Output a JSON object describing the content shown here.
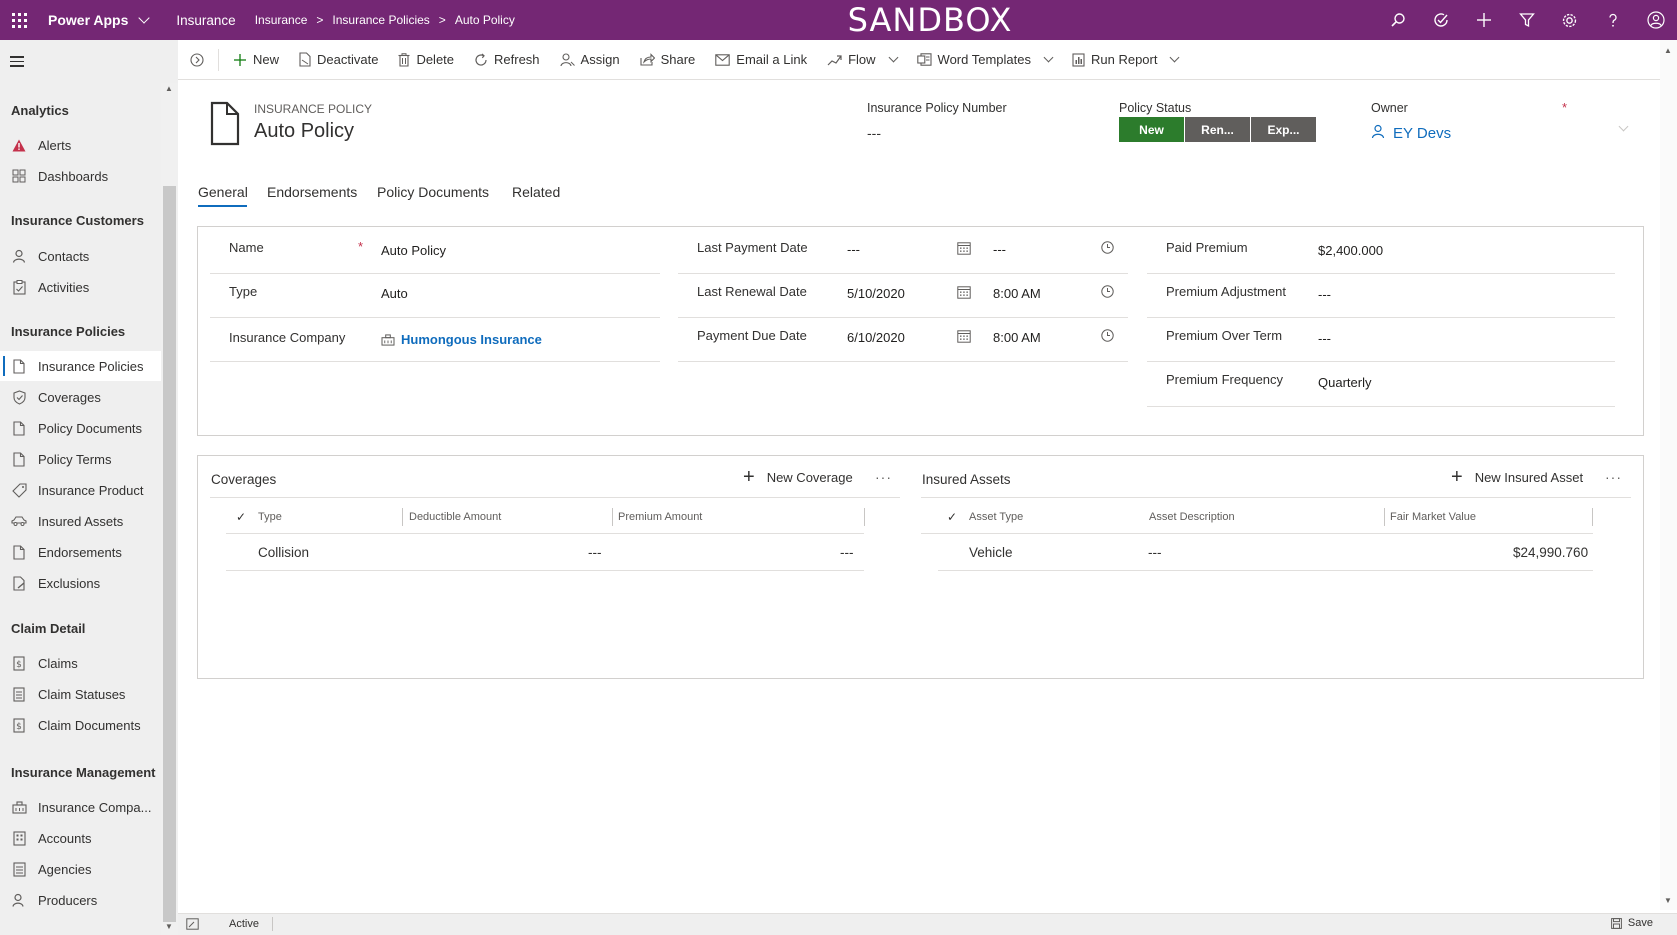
{
  "topbar": {
    "app_name": "Power Apps",
    "environment": "Insurance",
    "breadcrumbs": [
      "Insurance",
      "Insurance Policies",
      "Auto Policy"
    ],
    "banner": "SANDBOX",
    "icons": [
      "search-icon",
      "task-icon",
      "plus-icon",
      "filter-icon",
      "settings-icon",
      "help-icon"
    ]
  },
  "sidebar": {
    "groups": [
      {
        "title": "Analytics",
        "items": [
          {
            "label": "Alerts",
            "icon": "alert-icon"
          },
          {
            "label": "Dashboards",
            "icon": "dashboard-icon"
          }
        ]
      },
      {
        "title": "Insurance Customers",
        "items": [
          {
            "label": "Contacts",
            "icon": "person-icon"
          },
          {
            "label": "Activities",
            "icon": "clipboard-icon"
          }
        ]
      },
      {
        "title": "Insurance Policies",
        "items": [
          {
            "label": "Insurance Policies",
            "icon": "document-icon",
            "active": true
          },
          {
            "label": "Coverages",
            "icon": "shield-icon"
          },
          {
            "label": "Policy Documents",
            "icon": "document-icon"
          },
          {
            "label": "Policy Terms",
            "icon": "document-icon"
          },
          {
            "label": "Insurance Product",
            "icon": "tag-icon"
          },
          {
            "label": "Insured Assets",
            "icon": "car-icon"
          },
          {
            "label": "Endorsements",
            "icon": "document-icon"
          },
          {
            "label": "Exclusions",
            "icon": "document-edit-icon"
          }
        ]
      },
      {
        "title": "Claim Detail",
        "items": [
          {
            "label": "Claims",
            "icon": "dollar-doc-icon"
          },
          {
            "label": "Claim Statuses",
            "icon": "list-doc-icon"
          },
          {
            "label": "Claim Documents",
            "icon": "dollar-doc-icon"
          }
        ]
      },
      {
        "title": "Insurance Management",
        "items": [
          {
            "label": "Insurance Compa...",
            "icon": "building-icon"
          },
          {
            "label": "Accounts",
            "icon": "building-icon"
          },
          {
            "label": "Agencies",
            "icon": "building-icon"
          },
          {
            "label": "Producers",
            "icon": "person-icon"
          }
        ]
      }
    ]
  },
  "commands": {
    "new": "New",
    "deactivate": "Deactivate",
    "delete": "Delete",
    "refresh": "Refresh",
    "assign": "Assign",
    "share": "Share",
    "email_link": "Email a Link",
    "flow": "Flow",
    "word_templates": "Word Templates",
    "run_report": "Run Report"
  },
  "header": {
    "entity": "INSURANCE POLICY",
    "title": "Auto Policy",
    "policy_number_label": "Insurance Policy Number",
    "policy_number_value": "---",
    "status_label": "Policy Status",
    "status_stages": [
      {
        "label": "New",
        "active": true
      },
      {
        "label": "Ren...",
        "active": false
      },
      {
        "label": "Exp...",
        "active": false
      }
    ],
    "owner_label": "Owner",
    "owner_value": "EY Devs",
    "required_mark": "*"
  },
  "tabs": [
    "General",
    "Endorsements",
    "Policy Documents",
    "Related"
  ],
  "general": {
    "col1": [
      {
        "label": "Name",
        "value": "Auto Policy",
        "required": "*"
      },
      {
        "label": "Type",
        "value": "Auto"
      },
      {
        "label": "Insurance Company",
        "value": "Humongous Insurance"
      }
    ],
    "col2": [
      {
        "label": "Last Payment Date",
        "date": "---",
        "time": "---"
      },
      {
        "label": "Last Renewal Date",
        "date": "5/10/2020",
        "time": "8:00 AM"
      },
      {
        "label": "Payment Due Date",
        "date": "6/10/2020",
        "time": "8:00 AM"
      }
    ],
    "col3": [
      {
        "label": "Paid Premium",
        "value": "$2,400.000"
      },
      {
        "label": "Premium Adjustment",
        "value": "---"
      },
      {
        "label": "Premium Over Term",
        "value": "---"
      },
      {
        "label": "Premium Frequency",
        "value": "Quarterly"
      }
    ]
  },
  "coverages": {
    "title": "Coverages",
    "new_label": "New Coverage",
    "more": "···",
    "columns": [
      "Type",
      "Deductible Amount",
      "Premium Amount"
    ],
    "rows": [
      [
        "Collision",
        "---",
        "---"
      ]
    ]
  },
  "insured_assets": {
    "title": "Insured Assets",
    "new_label": "New Insured Asset",
    "more": "···",
    "columns": [
      "Asset Type",
      "Asset Description",
      "Fair Market Value"
    ],
    "rows": [
      [
        "Vehicle",
        "---",
        "$24,990.760"
      ]
    ]
  },
  "footer": {
    "status": "Active",
    "save": "Save"
  }
}
